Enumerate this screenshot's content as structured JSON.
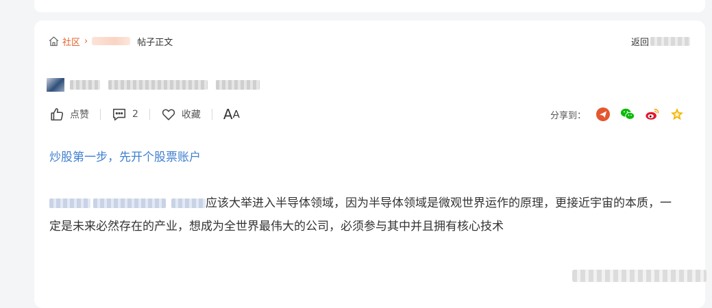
{
  "breadcrumb": {
    "community": "社区",
    "current": "帖子正文"
  },
  "back_label": "返回",
  "actions": {
    "like": "点赞",
    "comment_count": "2",
    "favorite": "收藏",
    "font_size_big": "A",
    "font_size_small": "A"
  },
  "share": {
    "label": "分享到："
  },
  "post": {
    "subtitle": "炒股第一步，先开个股票账户",
    "body_line1": "应该大举进入半导体领域，因为半导体领域是微观世界运作的原理，更接近宇宙的本质，一",
    "body_line2": "定是未来必然存在的产业，想成为全世界最伟大的公司，必须参与其中并且拥有核心技术"
  },
  "colors": {
    "accent": "#e3622a",
    "link_blue": "#3f7fd0",
    "weibo_red": "#e6162d",
    "wechat_green": "#09bb07",
    "star_yellow": "#f5b400"
  }
}
